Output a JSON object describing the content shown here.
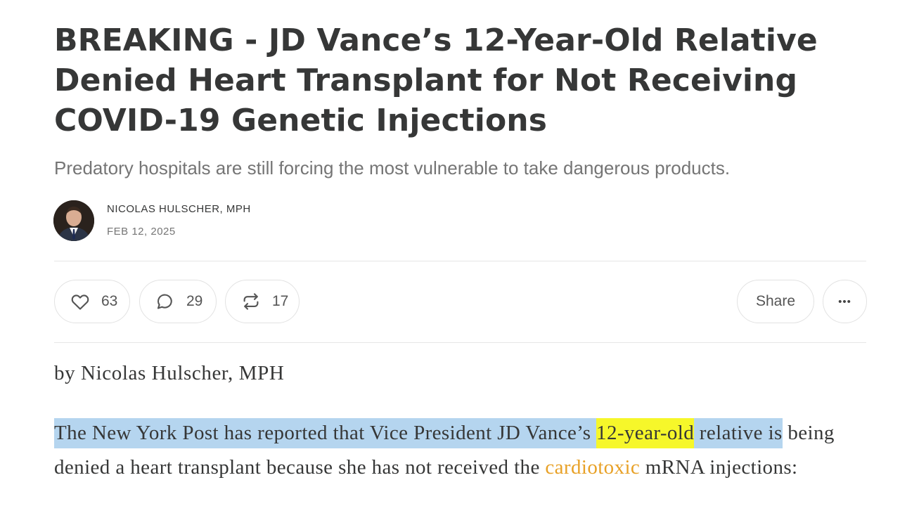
{
  "article": {
    "title": "BREAKING - JD Vance’s 12-Year-Old Relative Denied Heart Transplant for Not Receiving COVID-19 Genetic Injections",
    "subtitle": "Predatory hospitals are still forcing the most vulnerable to take dangerous products.",
    "author": "NICOLAS HULSCHER, MPH",
    "date": "FEB 12, 2025"
  },
  "actions": {
    "likes": "63",
    "comments": "29",
    "restacks": "17",
    "share_label": "Share",
    "more_label": "•••"
  },
  "body": {
    "byline": "by Nicolas Hulscher, MPH",
    "p1_selected_a": "The New York Post has reported that Vice President JD Vance’s ",
    "p1_highlight": "12-year-old",
    "p1_selected_b": " relative is",
    "p1_rest_a": " being denied a heart transplant because she has not received the ",
    "p1_link": "cardiotoxic",
    "p1_rest_b": " mRNA injections:"
  },
  "colors": {
    "text": "#363737",
    "muted": "#757575",
    "selection": "#b5d5ef",
    "highlight": "#f6f72a",
    "link": "#e8a127"
  }
}
